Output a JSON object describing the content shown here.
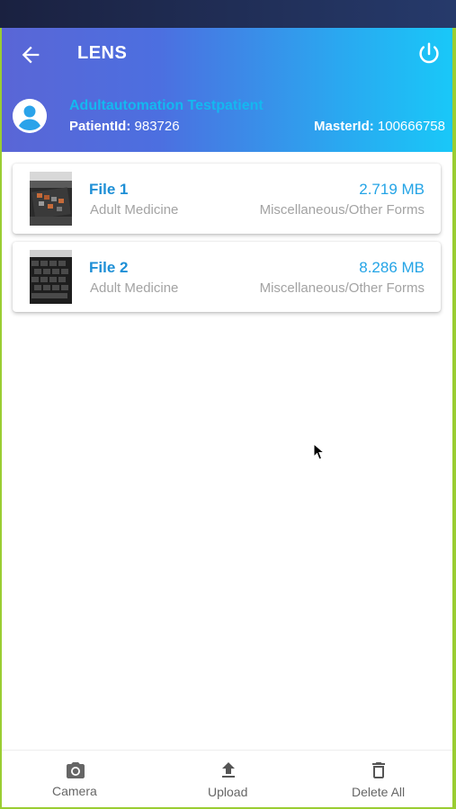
{
  "app": {
    "title": "LENS"
  },
  "patient": {
    "name": "Adultautomation Testpatient",
    "patient_id_label": "PatientId:",
    "patient_id": "983726",
    "master_id_label": "MasterId:",
    "master_id": "100666758"
  },
  "files": [
    {
      "name": "File 1",
      "size": "2.719 MB",
      "department": "Adult Medicine",
      "category": "Miscellaneous/Other Forms"
    },
    {
      "name": "File 2",
      "size": "8.286 MB",
      "department": "Adult Medicine",
      "category": "Miscellaneous/Other Forms"
    }
  ],
  "bottom_nav": {
    "camera_label": "Camera",
    "upload_label": "Upload",
    "delete_all_label": "Delete All"
  },
  "icons": {
    "back": "arrow-left-icon",
    "power": "power-icon",
    "avatar": "account-circle-icon",
    "camera": "camera-icon",
    "upload": "upload-icon",
    "delete": "trash-icon"
  },
  "colors": {
    "header_start": "#5a66d6",
    "header_end": "#19c8f8",
    "accent_blue": "#1e8fd6",
    "name_blue": "#14b8f0",
    "frame_green": "#9acd32"
  }
}
